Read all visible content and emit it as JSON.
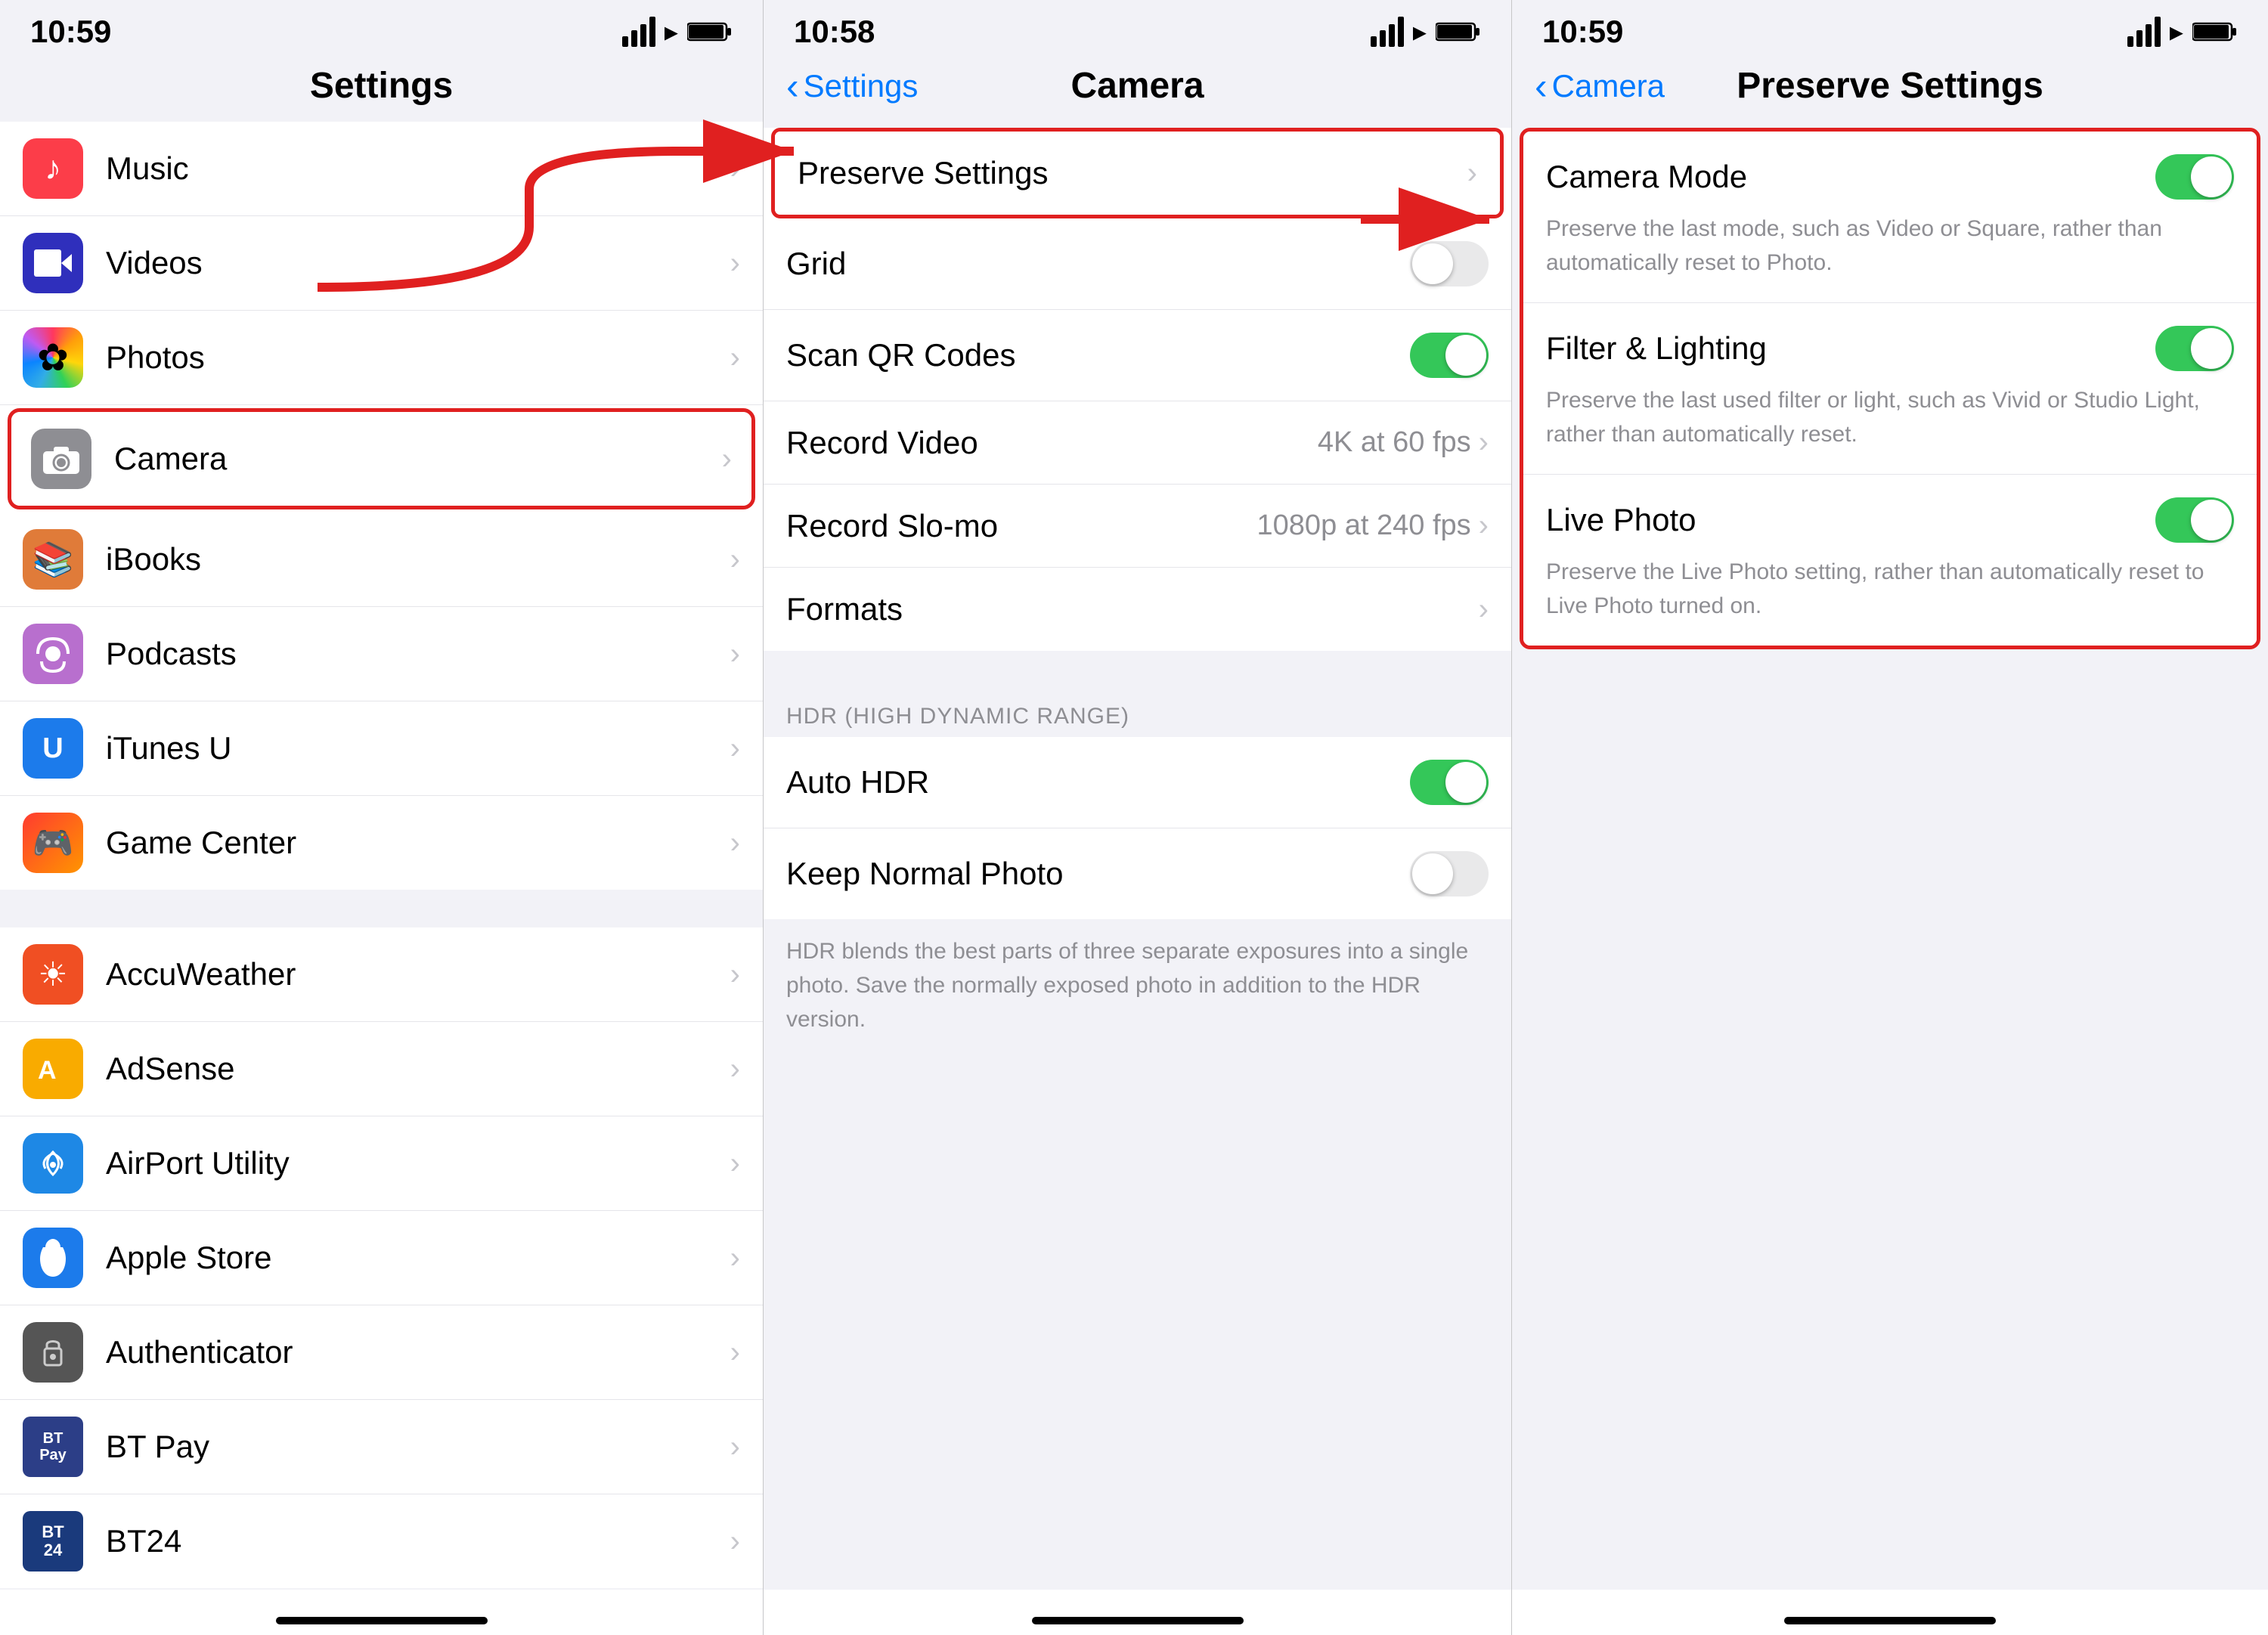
{
  "panel1": {
    "statusBar": {
      "time": "10:59",
      "signal": "signal",
      "wifi": "wifi",
      "battery": "battery"
    },
    "navTitle": "Settings",
    "items": [
      {
        "label": "Music",
        "icon": "music",
        "iconBg": "icon-music",
        "iconChar": "♪"
      },
      {
        "label": "Videos",
        "icon": "videos",
        "iconBg": "icon-videos",
        "iconChar": "▶"
      },
      {
        "label": "Photos",
        "icon": "photos",
        "iconBg": "icon-photos",
        "iconChar": "✿"
      },
      {
        "label": "Camera",
        "icon": "camera",
        "iconBg": "icon-camera",
        "iconChar": "📷"
      },
      {
        "label": "iBooks",
        "icon": "ibooks",
        "iconBg": "icon-ibooks",
        "iconChar": "📚"
      },
      {
        "label": "Podcasts",
        "icon": "podcasts",
        "iconBg": "icon-podcasts",
        "iconChar": "🎙"
      },
      {
        "label": "iTunes U",
        "icon": "itunes-u",
        "iconBg": "icon-itunes-u",
        "iconChar": "🎓"
      },
      {
        "label": "Game Center",
        "icon": "game-center",
        "iconBg": "icon-game-center",
        "iconChar": "🎮"
      }
    ],
    "items2": [
      {
        "label": "AccuWeather",
        "icon": "accuweather",
        "iconBg": "icon-accuweather",
        "iconChar": "☀"
      },
      {
        "label": "AdSense",
        "icon": "adsense",
        "iconBg": "icon-adsense",
        "iconChar": "A"
      },
      {
        "label": "AirPort Utility",
        "icon": "airport",
        "iconBg": "icon-airport",
        "iconChar": "📶"
      },
      {
        "label": "Apple Store",
        "icon": "apple-store",
        "iconBg": "icon-apple-store",
        "iconChar": ""
      },
      {
        "label": "Authenticator",
        "icon": "authenticator",
        "iconBg": "icon-authenticator",
        "iconChar": "🔒"
      },
      {
        "label": "BT Pay",
        "icon": "bt-pay",
        "iconBg": "icon-bt-pay",
        "iconChar": "BTPay"
      },
      {
        "label": "BT24",
        "icon": "bt24",
        "iconBg": "icon-bt24",
        "iconChar": "BT 24"
      }
    ]
  },
  "panel2": {
    "statusBar": {
      "time": "10:58"
    },
    "navBack": "Settings",
    "navTitle": "Camera",
    "items": [
      {
        "label": "Preserve Settings",
        "type": "nav",
        "highlighted": true
      },
      {
        "label": "Grid",
        "type": "toggle",
        "value": false
      },
      {
        "label": "Scan QR Codes",
        "type": "toggle",
        "value": true
      },
      {
        "label": "Record Video",
        "type": "nav",
        "value": "4K at 60 fps"
      },
      {
        "label": "Record Slo-mo",
        "type": "nav",
        "value": "1080p at 240 fps"
      },
      {
        "label": "Formats",
        "type": "nav"
      }
    ],
    "hdrHeader": "HDR (HIGH DYNAMIC RANGE)",
    "hdrItems": [
      {
        "label": "Auto HDR",
        "type": "toggle",
        "value": true
      },
      {
        "label": "Keep Normal Photo",
        "type": "toggle",
        "value": false
      }
    ],
    "hdrDesc": "HDR blends the best parts of three separate exposures into a single photo. Save the normally exposed photo in addition to the HDR version."
  },
  "panel3": {
    "statusBar": {
      "time": "10:59"
    },
    "navBack": "Camera",
    "navTitle": "Preserve Settings",
    "items": [
      {
        "label": "Camera Mode",
        "value": true,
        "desc": "Preserve the last mode, such as Video or Square, rather than automatically reset to Photo.",
        "highlighted": true
      },
      {
        "label": "Filter & Lighting",
        "value": true,
        "desc": "Preserve the last used filter or light, such as Vivid or Studio Light, rather than automatically reset.",
        "highlighted": true
      },
      {
        "label": "Live Photo",
        "value": true,
        "desc": "Preserve the Live Photo setting, rather than automatically reset to Live Photo turned on.",
        "highlighted": true
      }
    ]
  },
  "labels": {
    "chevron": "›",
    "backArrow": "‹"
  }
}
